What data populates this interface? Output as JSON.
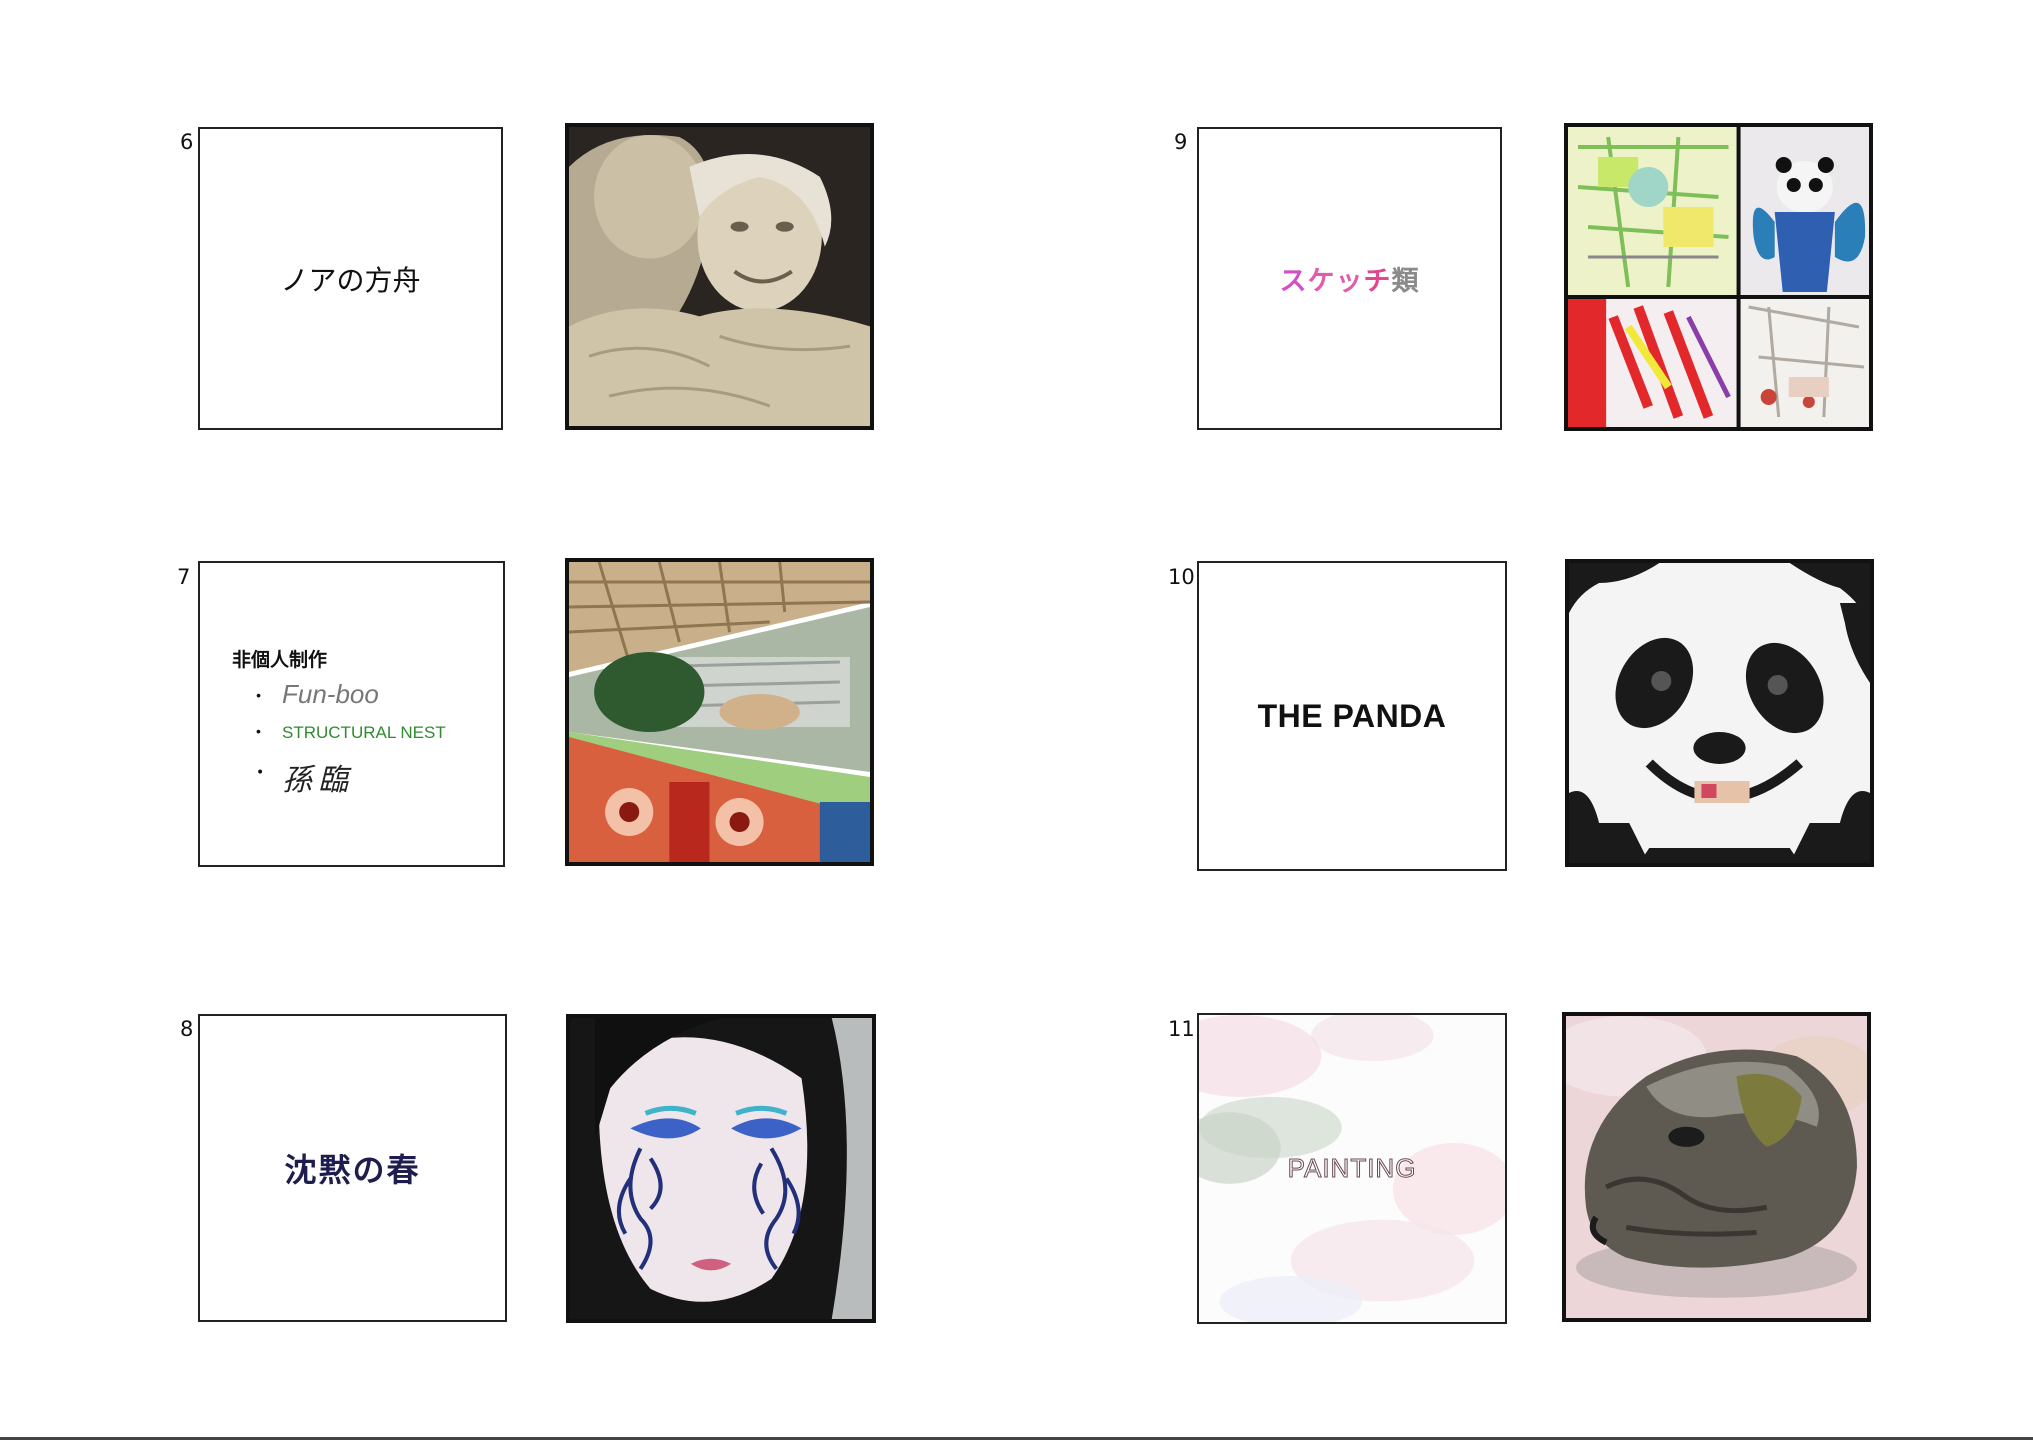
{
  "items": [
    {
      "number": "6",
      "title": "ノアの方舟"
    },
    {
      "number": "7",
      "heading": "非個人制作",
      "list": [
        "Fun-boo",
        "STRUCTURAL NEST",
        "孫臨"
      ]
    },
    {
      "number": "8",
      "title": "沈黙の春"
    },
    {
      "number": "9",
      "title_parts": [
        "ス",
        "ケッ",
        "チ",
        "類"
      ]
    },
    {
      "number": "10",
      "title": "THE PANDA"
    },
    {
      "number": "11",
      "title": "PAINTING"
    }
  ],
  "colors": {
    "sketch_magenta": "#d24fc9",
    "sketch_pink": "#e0478e",
    "structural_green": "#2e8b2e",
    "spring_navy": "#1e1e4e"
  }
}
